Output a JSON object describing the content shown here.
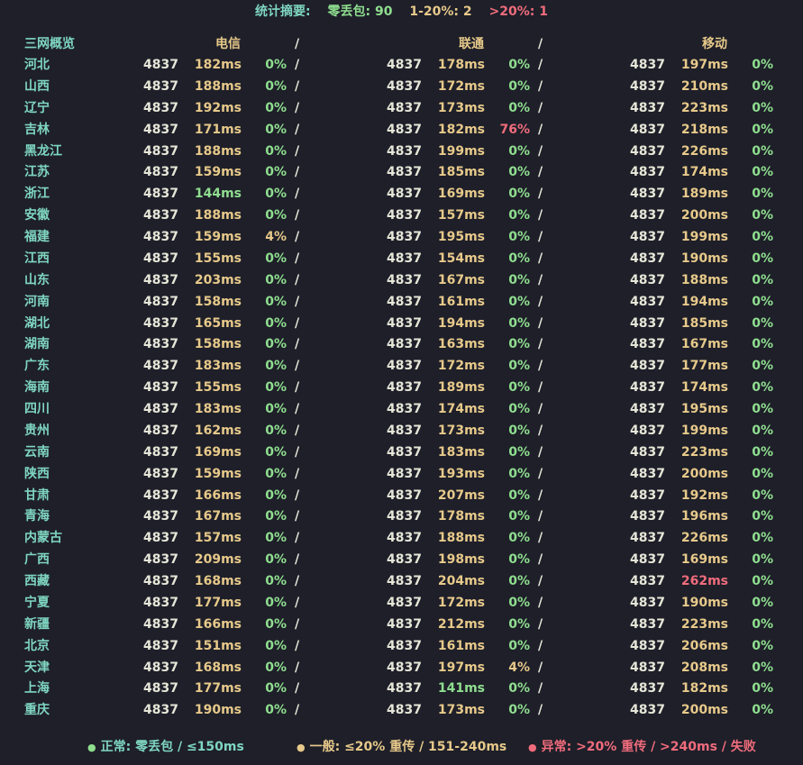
{
  "summary": {
    "label": "统计摘要:",
    "zero_loss": "零丢包: 90",
    "mid_loss": "1-20%: 2",
    "high_loss": ">20%: 1"
  },
  "header": {
    "overview": "三网概览",
    "telecom": "电信",
    "unicom": "联通",
    "mobile": "移动",
    "slash": "/"
  },
  "colors": {
    "background": "#1e1f29",
    "normal": "#8fde8f",
    "medium": "#e7c98a",
    "abnormal": "#f06c7c",
    "label": "#7fd6c0"
  },
  "rows": [
    {
      "province": "河北",
      "ct": {
        "count": "4837",
        "latency": "182ms",
        "loss": "0%"
      },
      "cu": {
        "count": "4837",
        "latency": "178ms",
        "loss": "0%"
      },
      "cm": {
        "count": "4837",
        "latency": "197ms",
        "loss": "0%"
      }
    },
    {
      "province": "山西",
      "ct": {
        "count": "4837",
        "latency": "188ms",
        "loss": "0%"
      },
      "cu": {
        "count": "4837",
        "latency": "172ms",
        "loss": "0%"
      },
      "cm": {
        "count": "4837",
        "latency": "210ms",
        "loss": "0%"
      }
    },
    {
      "province": "辽宁",
      "ct": {
        "count": "4837",
        "latency": "192ms",
        "loss": "0%"
      },
      "cu": {
        "count": "4837",
        "latency": "173ms",
        "loss": "0%"
      },
      "cm": {
        "count": "4837",
        "latency": "223ms",
        "loss": "0%"
      }
    },
    {
      "province": "吉林",
      "ct": {
        "count": "4837",
        "latency": "171ms",
        "loss": "0%"
      },
      "cu": {
        "count": "4837",
        "latency": "182ms",
        "loss": "76%"
      },
      "cm": {
        "count": "4837",
        "latency": "218ms",
        "loss": "0%"
      }
    },
    {
      "province": "黑龙江",
      "ct": {
        "count": "4837",
        "latency": "188ms",
        "loss": "0%"
      },
      "cu": {
        "count": "4837",
        "latency": "199ms",
        "loss": "0%"
      },
      "cm": {
        "count": "4837",
        "latency": "226ms",
        "loss": "0%"
      }
    },
    {
      "province": "江苏",
      "ct": {
        "count": "4837",
        "latency": "159ms",
        "loss": "0%"
      },
      "cu": {
        "count": "4837",
        "latency": "185ms",
        "loss": "0%"
      },
      "cm": {
        "count": "4837",
        "latency": "174ms",
        "loss": "0%"
      }
    },
    {
      "province": "浙江",
      "ct": {
        "count": "4837",
        "latency": "144ms",
        "loss": "0%"
      },
      "cu": {
        "count": "4837",
        "latency": "169ms",
        "loss": "0%"
      },
      "cm": {
        "count": "4837",
        "latency": "189ms",
        "loss": "0%"
      }
    },
    {
      "province": "安徽",
      "ct": {
        "count": "4837",
        "latency": "188ms",
        "loss": "0%"
      },
      "cu": {
        "count": "4837",
        "latency": "157ms",
        "loss": "0%"
      },
      "cm": {
        "count": "4837",
        "latency": "200ms",
        "loss": "0%"
      }
    },
    {
      "province": "福建",
      "ct": {
        "count": "4837",
        "latency": "159ms",
        "loss": "4%"
      },
      "cu": {
        "count": "4837",
        "latency": "195ms",
        "loss": "0%"
      },
      "cm": {
        "count": "4837",
        "latency": "199ms",
        "loss": "0%"
      }
    },
    {
      "province": "江西",
      "ct": {
        "count": "4837",
        "latency": "155ms",
        "loss": "0%"
      },
      "cu": {
        "count": "4837",
        "latency": "154ms",
        "loss": "0%"
      },
      "cm": {
        "count": "4837",
        "latency": "190ms",
        "loss": "0%"
      }
    },
    {
      "province": "山东",
      "ct": {
        "count": "4837",
        "latency": "203ms",
        "loss": "0%"
      },
      "cu": {
        "count": "4837",
        "latency": "167ms",
        "loss": "0%"
      },
      "cm": {
        "count": "4837",
        "latency": "188ms",
        "loss": "0%"
      }
    },
    {
      "province": "河南",
      "ct": {
        "count": "4837",
        "latency": "158ms",
        "loss": "0%"
      },
      "cu": {
        "count": "4837",
        "latency": "161ms",
        "loss": "0%"
      },
      "cm": {
        "count": "4837",
        "latency": "194ms",
        "loss": "0%"
      }
    },
    {
      "province": "湖北",
      "ct": {
        "count": "4837",
        "latency": "165ms",
        "loss": "0%"
      },
      "cu": {
        "count": "4837",
        "latency": "194ms",
        "loss": "0%"
      },
      "cm": {
        "count": "4837",
        "latency": "185ms",
        "loss": "0%"
      }
    },
    {
      "province": "湖南",
      "ct": {
        "count": "4837",
        "latency": "158ms",
        "loss": "0%"
      },
      "cu": {
        "count": "4837",
        "latency": "163ms",
        "loss": "0%"
      },
      "cm": {
        "count": "4837",
        "latency": "167ms",
        "loss": "0%"
      }
    },
    {
      "province": "广东",
      "ct": {
        "count": "4837",
        "latency": "183ms",
        "loss": "0%"
      },
      "cu": {
        "count": "4837",
        "latency": "172ms",
        "loss": "0%"
      },
      "cm": {
        "count": "4837",
        "latency": "177ms",
        "loss": "0%"
      }
    },
    {
      "province": "海南",
      "ct": {
        "count": "4837",
        "latency": "155ms",
        "loss": "0%"
      },
      "cu": {
        "count": "4837",
        "latency": "189ms",
        "loss": "0%"
      },
      "cm": {
        "count": "4837",
        "latency": "174ms",
        "loss": "0%"
      }
    },
    {
      "province": "四川",
      "ct": {
        "count": "4837",
        "latency": "183ms",
        "loss": "0%"
      },
      "cu": {
        "count": "4837",
        "latency": "174ms",
        "loss": "0%"
      },
      "cm": {
        "count": "4837",
        "latency": "195ms",
        "loss": "0%"
      }
    },
    {
      "province": "贵州",
      "ct": {
        "count": "4837",
        "latency": "162ms",
        "loss": "0%"
      },
      "cu": {
        "count": "4837",
        "latency": "173ms",
        "loss": "0%"
      },
      "cm": {
        "count": "4837",
        "latency": "199ms",
        "loss": "0%"
      }
    },
    {
      "province": "云南",
      "ct": {
        "count": "4837",
        "latency": "169ms",
        "loss": "0%"
      },
      "cu": {
        "count": "4837",
        "latency": "183ms",
        "loss": "0%"
      },
      "cm": {
        "count": "4837",
        "latency": "223ms",
        "loss": "0%"
      }
    },
    {
      "province": "陕西",
      "ct": {
        "count": "4837",
        "latency": "159ms",
        "loss": "0%"
      },
      "cu": {
        "count": "4837",
        "latency": "193ms",
        "loss": "0%"
      },
      "cm": {
        "count": "4837",
        "latency": "200ms",
        "loss": "0%"
      }
    },
    {
      "province": "甘肃",
      "ct": {
        "count": "4837",
        "latency": "166ms",
        "loss": "0%"
      },
      "cu": {
        "count": "4837",
        "latency": "207ms",
        "loss": "0%"
      },
      "cm": {
        "count": "4837",
        "latency": "192ms",
        "loss": "0%"
      }
    },
    {
      "province": "青海",
      "ct": {
        "count": "4837",
        "latency": "167ms",
        "loss": "0%"
      },
      "cu": {
        "count": "4837",
        "latency": "178ms",
        "loss": "0%"
      },
      "cm": {
        "count": "4837",
        "latency": "196ms",
        "loss": "0%"
      }
    },
    {
      "province": "内蒙古",
      "ct": {
        "count": "4837",
        "latency": "157ms",
        "loss": "0%"
      },
      "cu": {
        "count": "4837",
        "latency": "188ms",
        "loss": "0%"
      },
      "cm": {
        "count": "4837",
        "latency": "226ms",
        "loss": "0%"
      }
    },
    {
      "province": "广西",
      "ct": {
        "count": "4837",
        "latency": "209ms",
        "loss": "0%"
      },
      "cu": {
        "count": "4837",
        "latency": "198ms",
        "loss": "0%"
      },
      "cm": {
        "count": "4837",
        "latency": "169ms",
        "loss": "0%"
      }
    },
    {
      "province": "西藏",
      "ct": {
        "count": "4837",
        "latency": "168ms",
        "loss": "0%"
      },
      "cu": {
        "count": "4837",
        "latency": "204ms",
        "loss": "0%"
      },
      "cm": {
        "count": "4837",
        "latency": "262ms",
        "loss": "0%"
      }
    },
    {
      "province": "宁夏",
      "ct": {
        "count": "4837",
        "latency": "177ms",
        "loss": "0%"
      },
      "cu": {
        "count": "4837",
        "latency": "172ms",
        "loss": "0%"
      },
      "cm": {
        "count": "4837",
        "latency": "190ms",
        "loss": "0%"
      }
    },
    {
      "province": "新疆",
      "ct": {
        "count": "4837",
        "latency": "166ms",
        "loss": "0%"
      },
      "cu": {
        "count": "4837",
        "latency": "212ms",
        "loss": "0%"
      },
      "cm": {
        "count": "4837",
        "latency": "223ms",
        "loss": "0%"
      }
    },
    {
      "province": "北京",
      "ct": {
        "count": "4837",
        "latency": "151ms",
        "loss": "0%"
      },
      "cu": {
        "count": "4837",
        "latency": "161ms",
        "loss": "0%"
      },
      "cm": {
        "count": "4837",
        "latency": "206ms",
        "loss": "0%"
      }
    },
    {
      "province": "天津",
      "ct": {
        "count": "4837",
        "latency": "168ms",
        "loss": "0%"
      },
      "cu": {
        "count": "4837",
        "latency": "197ms",
        "loss": "4%"
      },
      "cm": {
        "count": "4837",
        "latency": "208ms",
        "loss": "0%"
      }
    },
    {
      "province": "上海",
      "ct": {
        "count": "4837",
        "latency": "177ms",
        "loss": "0%"
      },
      "cu": {
        "count": "4837",
        "latency": "141ms",
        "loss": "0%"
      },
      "cm": {
        "count": "4837",
        "latency": "182ms",
        "loss": "0%"
      }
    },
    {
      "province": "重庆",
      "ct": {
        "count": "4837",
        "latency": "190ms",
        "loss": "0%"
      },
      "cu": {
        "count": "4837",
        "latency": "173ms",
        "loss": "0%"
      },
      "cm": {
        "count": "4837",
        "latency": "200ms",
        "loss": "0%"
      }
    }
  ],
  "legend": {
    "normal": "正常: 零丢包 / ≤150ms",
    "medium": "一般: ≤20% 重传 / 151-240ms",
    "abnormal": "异常: >20% 重传 / >240ms / 失败",
    "dot_icon": "●"
  }
}
